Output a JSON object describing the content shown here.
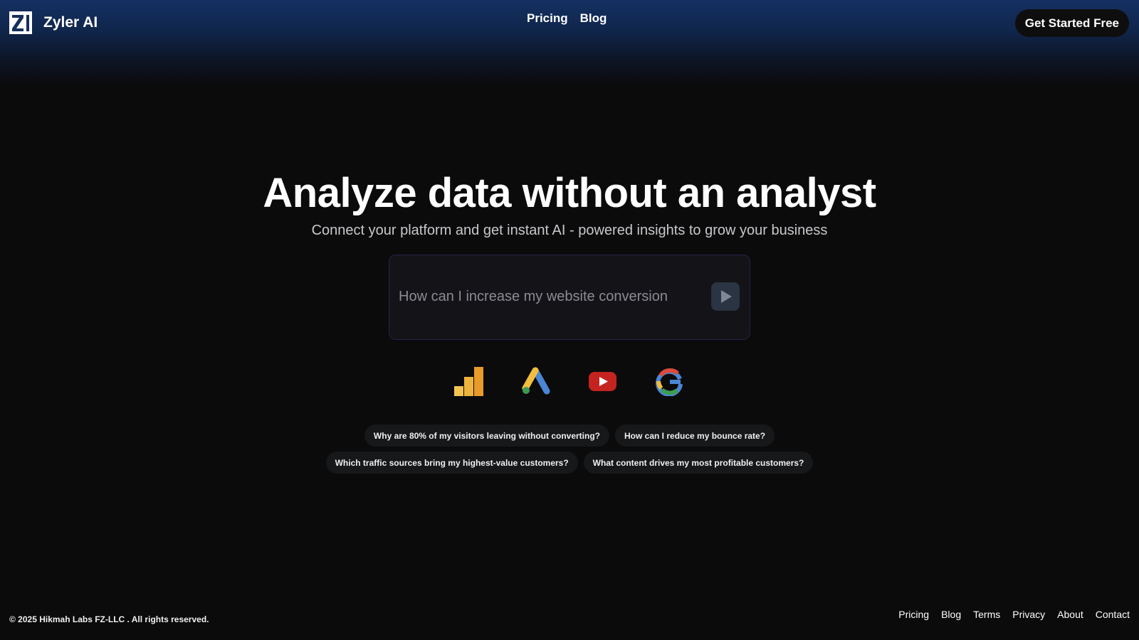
{
  "brand": {
    "name": "Zyler AI",
    "logo_icon": "zyler-logo-mark"
  },
  "topnav": {
    "items": [
      {
        "label": "Pricing"
      },
      {
        "label": "Blog"
      }
    ]
  },
  "header": {
    "cta_label": "Get Started Free"
  },
  "hero": {
    "title": "Analyze data without an analyst",
    "subtitle": "Connect your platform and get instant AI - powered insights to grow your business"
  },
  "search": {
    "placeholder": "How can I increase my website conversion",
    "value": "",
    "send_icon": "play-icon"
  },
  "integrations": [
    {
      "name": "google-analytics-icon",
      "color": "#f2b441"
    },
    {
      "name": "google-ads-icon",
      "color": "#4a86d4"
    },
    {
      "name": "youtube-icon",
      "color": "#c4231f"
    },
    {
      "name": "google-icon",
      "color": "#4a86d4"
    }
  ],
  "suggestions": {
    "row1": [
      {
        "label": "Why are 80% of my visitors leaving without converting?"
      },
      {
        "label": "How can I reduce my bounce rate?"
      }
    ],
    "row2": [
      {
        "label": "Which traffic sources bring my highest-value customers?"
      },
      {
        "label": "What content drives my most profitable customers?"
      }
    ]
  },
  "footer": {
    "copyright": "© 2025 Hikmah Labs FZ-LLC . All rights reserved.",
    "links": [
      {
        "label": "Pricing"
      },
      {
        "label": "Blog"
      },
      {
        "label": "Terms"
      },
      {
        "label": "Privacy"
      },
      {
        "label": "About"
      },
      {
        "label": "Contact"
      }
    ]
  },
  "colors": {
    "background": "#0b0b0c",
    "header_gradient_top": "#143062",
    "accent_border": "#23234a"
  }
}
